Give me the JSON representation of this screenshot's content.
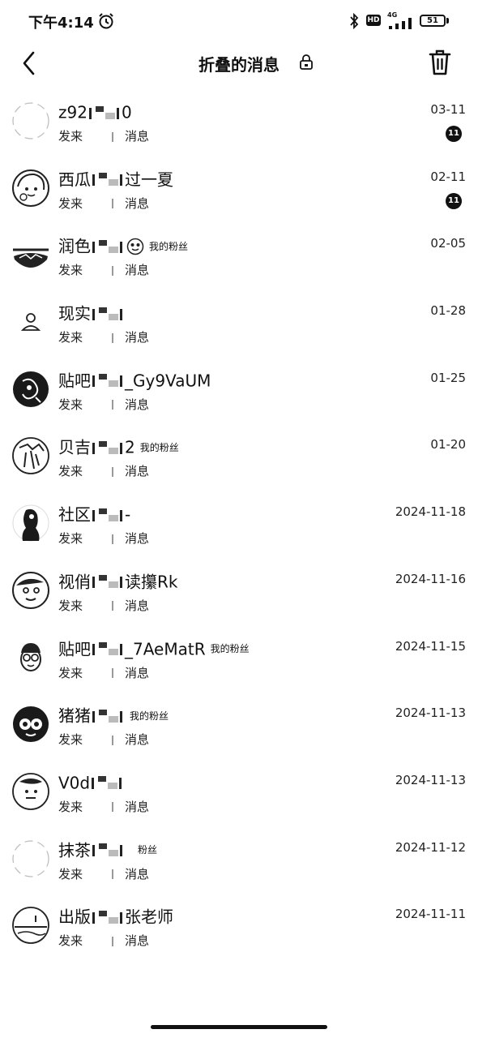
{
  "status_bar": {
    "time": "下午4:14",
    "hd": "HD",
    "network": "4G",
    "battery": "51"
  },
  "header": {
    "title": "折叠的消息"
  },
  "messages": [
    {
      "avatar": "empty-circle",
      "name_prefix": "z92",
      "name_suffix": "0",
      "date": "03-11",
      "sub_prefix": "发来",
      "sub_suffix": "消息",
      "badge": "11"
    },
    {
      "avatar": "cartoon-girl",
      "name_prefix": "西瓜",
      "name_suffix": "过一夏",
      "date": "02-11",
      "sub_prefix": "发来",
      "sub_suffix": "消息",
      "badge": "11"
    },
    {
      "avatar": "landscape",
      "name_prefix": "润色",
      "extra_icon": "face-emoji-icon",
      "tag": "我的粉丝",
      "date": "02-05",
      "sub_prefix": "发来",
      "sub_suffix": "消息"
    },
    {
      "avatar": "person-outline",
      "name_prefix": "现实",
      "date": "01-28",
      "sub_prefix": "发来",
      "sub_suffix": "消息"
    },
    {
      "avatar": "dark-art",
      "name_prefix": "贴吧",
      "name_suffix": "_Gy9VaUM",
      "date": "01-25",
      "sub_prefix": "发来",
      "sub_suffix": "消息"
    },
    {
      "avatar": "sketch-figure",
      "name_prefix": "贝吉",
      "name_suffix": "2",
      "tag": "我的粉丝",
      "date": "01-20",
      "sub_prefix": "发来",
      "sub_suffix": "消息"
    },
    {
      "avatar": "dark-woman",
      "name_prefix": "社区",
      "name_suffix": "-",
      "date": "2024-11-18",
      "sub_prefix": "发来",
      "sub_suffix": "消息"
    },
    {
      "avatar": "comic-face",
      "name_prefix": "视俏",
      "name_suffix": "读攥Rk",
      "date": "2024-11-16",
      "sub_prefix": "发来",
      "sub_suffix": "消息"
    },
    {
      "avatar": "glasses-face",
      "name_prefix": "贴吧",
      "name_suffix": "_7AeMatR",
      "tag": "我的粉丝",
      "date": "2024-11-15",
      "sub_prefix": "发来",
      "sub_suffix": "消息"
    },
    {
      "avatar": "glasses-dark",
      "name_prefix": "猪猪",
      "tag": "我的粉丝",
      "date": "2024-11-13",
      "sub_prefix": "发来",
      "sub_suffix": "消息"
    },
    {
      "avatar": "doodle-face",
      "name_prefix": "V0d",
      "date": "2024-11-13",
      "sub_prefix": "发来",
      "sub_suffix": "消息"
    },
    {
      "avatar": "empty-circle",
      "name_prefix": "抹茶",
      "tag": "粉丝",
      "tag_far": true,
      "date": "2024-11-12",
      "sub_prefix": "发来",
      "sub_suffix": "消息"
    },
    {
      "avatar": "landscape-sketch",
      "name_prefix": "出版",
      "name_suffix": "张老师",
      "date": "2024-11-11",
      "sub_prefix": "发来",
      "sub_suffix": "消息"
    }
  ]
}
